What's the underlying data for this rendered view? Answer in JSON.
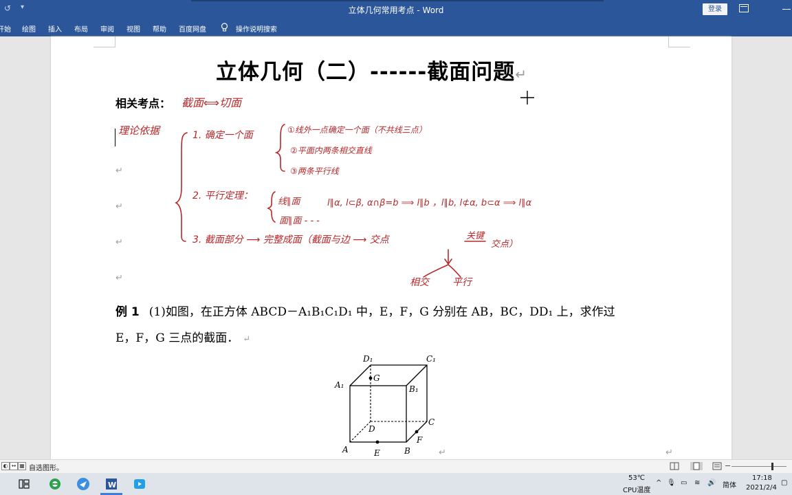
{
  "window": {
    "title": "立体几何常用考点 - Word",
    "signin_label": "登录"
  },
  "ribbon": {
    "tabs": [
      "开始",
      "绘图",
      "插入",
      "布局",
      "审阅",
      "视图",
      "帮助",
      "百度网盘"
    ],
    "tell_me": "操作说明搜索"
  },
  "document": {
    "title": "立体几何（二）------截面问题",
    "kaodian_label": "相关考点：",
    "handwriting": {
      "line1": "截面⟺切面",
      "basis_label": "理论依据",
      "item1": "1. 确定一个面",
      "item1_sub1": "①线外一点确定一个面（不共线三点）",
      "item1_sub2": "②平面内两条相交直线",
      "item1_sub3": "③两条平行线",
      "item2": "2. 平行定理：",
      "item2_sub1a": "线∥面",
      "item2_sub1b": "l∥α, l⊂β, α∩β=b ⟹ l∥b ，l∥b, l⊄α, b⊂α ⟹ l∥α",
      "item2_sub2": "面∥面 - - -",
      "item3": "3. 截面部分 ⟶ 完整成面（截面与边 ⟶ 交点",
      "item3_key": "关键",
      "item3_end": "交点）",
      "bottom_left": "相交",
      "bottom_right": "平行"
    },
    "example": {
      "label": "例 1",
      "line1": "(1)如图，在正方体 ABCD－A₁B₁C₁D₁ 中，E，F，G 分别在 AB，BC，DD₁ 上，求作过",
      "line2": "E，F，G 三点的截面．"
    },
    "cube_labels": {
      "D1": "D₁",
      "C1": "C₁",
      "A1": "A₁",
      "B1": "B₁",
      "G": "G",
      "C": "C",
      "D": "D",
      "F": "F",
      "A": "A",
      "E": "E",
      "B": "B"
    }
  },
  "statusbar": {
    "message": "自选图形。"
  },
  "taskbar": {
    "temp": "53℃",
    "temp_label": "CPU温度",
    "ime": "简体",
    "time": "17:18",
    "date": "2021/2/4"
  }
}
